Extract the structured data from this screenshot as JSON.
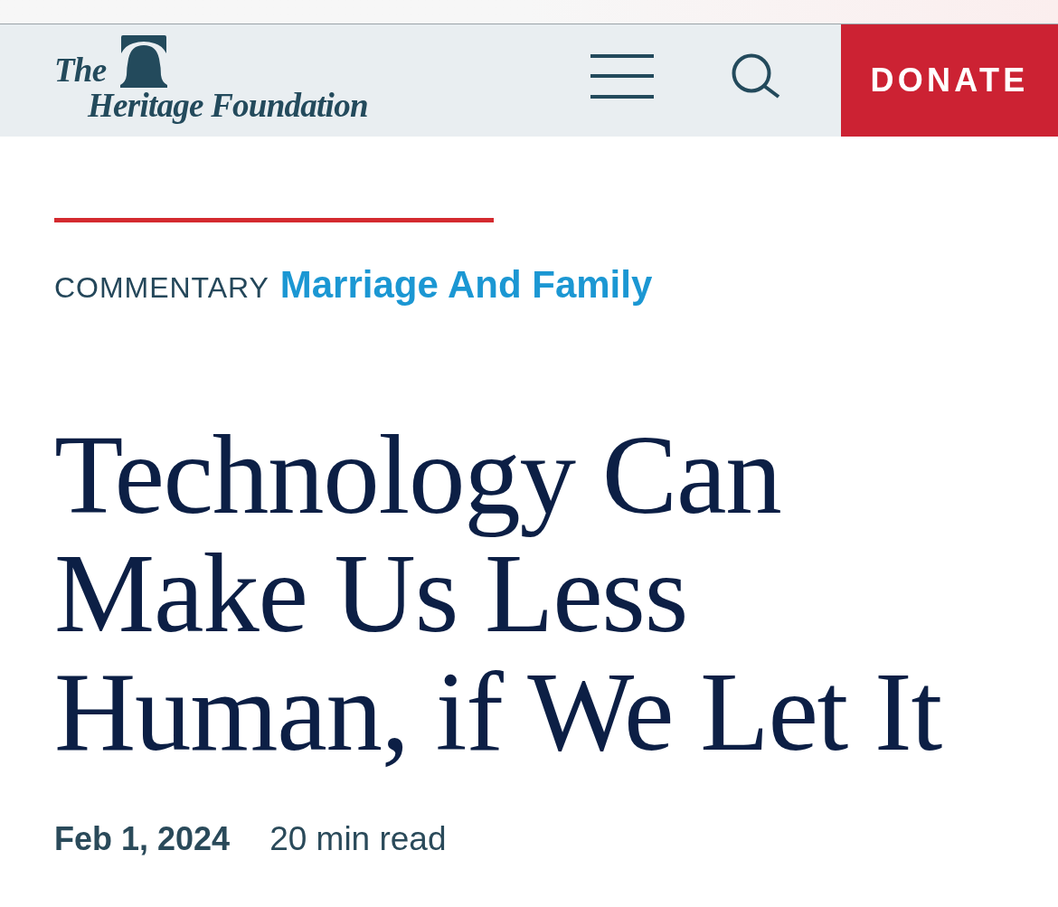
{
  "header": {
    "logo": {
      "line_1": "The",
      "line_2": "Heritage Foundation"
    },
    "donate_button": "DONATE"
  },
  "article": {
    "category": {
      "type": "COMMENTARY",
      "topic": "Marriage And Family"
    },
    "title": "Technology Can Make Us Less Human, if We Let It",
    "date": "Feb 1, 2024",
    "read_time": "20 min read"
  }
}
